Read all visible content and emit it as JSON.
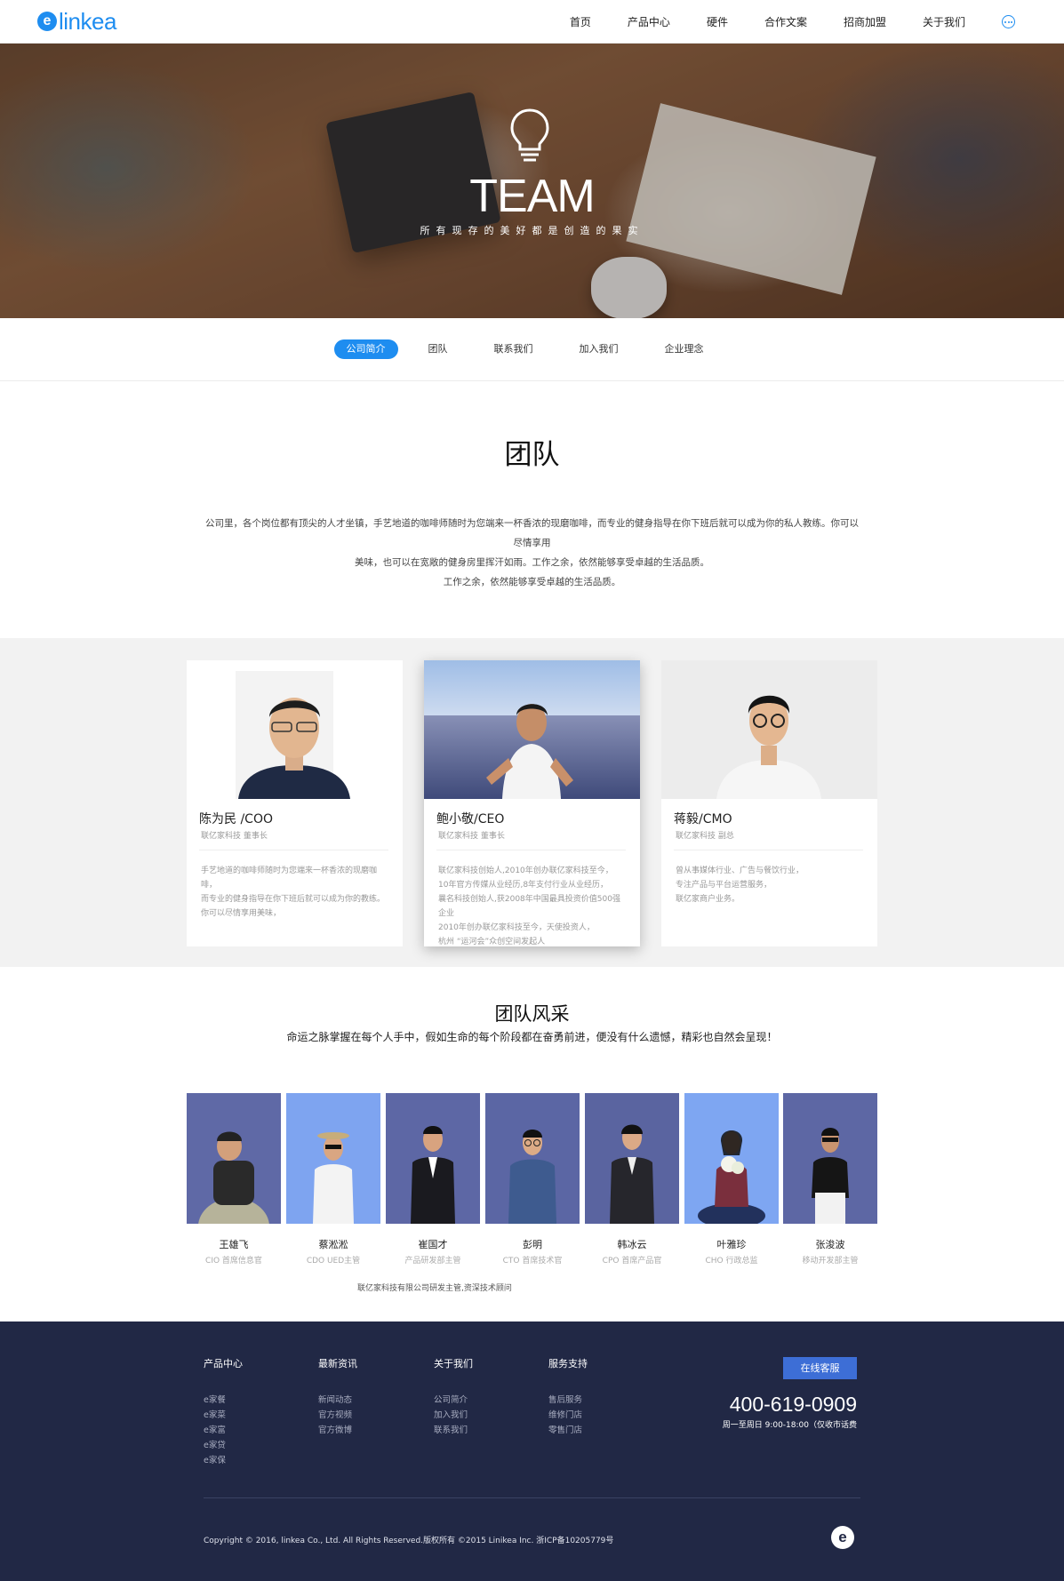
{
  "header": {
    "logo_mark": "e",
    "logo_text": "linkea",
    "nav": [
      "首页",
      "产品中心",
      "硬件",
      "合作文案",
      "招商加盟",
      "关于我们"
    ],
    "more_icon": "more-dots-icon",
    "brand_color": "#1e8df0"
  },
  "hero": {
    "title": "TEAM",
    "subtitle": "所有现存的美好都是创造的果实",
    "icon": "lightbulb-icon"
  },
  "tabs": [
    {
      "label": "公司简介",
      "active": true
    },
    {
      "label": "团队",
      "active": false
    },
    {
      "label": "联系我们",
      "active": false
    },
    {
      "label": "加入我们",
      "active": false
    },
    {
      "label": "企业理念",
      "active": false
    }
  ],
  "intro": {
    "title": "团队",
    "line1": "公司里，各个岗位都有顶尖的人才坐镇，手艺地道的咖啡师随时为您端来一杯香浓的现磨咖啡，而专业的健身指导在你下班后就可以成为你的私人教练。你可以尽情享用",
    "line2": "美味，也可以在宽敞的健身房里挥汗如雨。工作之余，依然能够享受卓越的生活品质。",
    "line3": "工作之余，依然能够享受卓越的生活品质。"
  },
  "leaders": [
    {
      "name": "陈为民 /COO",
      "title": "联亿家科技 董事长",
      "desc": [
        "手艺地道的咖啡师随时为您端来一杯香浓的现磨咖啡，",
        "而专业的健身指导在你下班后就可以成为你的教练。",
        "你可以尽情享用美味，"
      ]
    },
    {
      "name": "鲍小敬/CEO",
      "title": "联亿家科技 董事长",
      "desc": [
        "联亿家科技创始人,2010年创办联亿家科技至今，",
        "10年官方传媒从业经历,8年支付行业从业经历，",
        "曩名科技创始人,获2008年中国最具投资价值500强企业",
        "2010年创办联亿家科技至今，天使投资人，",
        "杭州 “运河会”众创空间发起人"
      ]
    },
    {
      "name": "蒋毅/CMO",
      "title": "联亿家科技 副总",
      "desc": [
        "曾从事媒体行业、广告与餐饮行业，",
        "专注产品与平台运营服务，",
        "联亿家商户业务。"
      ]
    }
  ],
  "team": {
    "title": "团队风采",
    "subtitle": "命运之脉掌握在每个人手中，假如生命的每个阶段都在奋勇前进，便没有什么遗憾，精彩也自然会呈现！",
    "members": [
      {
        "name": "王雄飞",
        "role": "CIO 首席信息官"
      },
      {
        "name": "蔡淞淞",
        "role": "CDO UED主管"
      },
      {
        "name": "崔国才",
        "role": "产品研发部主管"
      },
      {
        "name": "彭明",
        "role": "CTO 首席技术官"
      },
      {
        "name": "韩冰云",
        "role": "CPO 首席产品官"
      },
      {
        "name": "叶雅珍",
        "role": "CHO 行政总监"
      },
      {
        "name": "张浚波",
        "role": "移动开发部主管"
      }
    ],
    "note": "联亿家科技有限公司研发主管,资深技术顾问"
  },
  "footer": {
    "columns": [
      {
        "title": "产品中心",
        "links": [
          "e家餐",
          "e家菜",
          "e家富",
          "e家贷",
          "e家保"
        ]
      },
      {
        "title": "最新资讯",
        "links": [
          "新闻动态",
          "官方视频",
          "官方微博"
        ]
      },
      {
        "title": "关于我们",
        "links": [
          "公司简介",
          "加入我们",
          "联系我们"
        ]
      },
      {
        "title": "服务支持",
        "links": [
          "售后服务",
          "维修门店",
          "零售门店"
        ]
      }
    ],
    "service_button": "在线客服",
    "phone": "400-619-0909",
    "hours": "周一至周日 9:00-18:00（仅收市话费",
    "copyright": "Copyright © 2016, linkea  Co., Ltd. All Rights Reserved.版权所有 ©2015 Linikea Inc. 浙ICP备10205779号",
    "logo_mark": "e",
    "bg_color": "#212845"
  }
}
